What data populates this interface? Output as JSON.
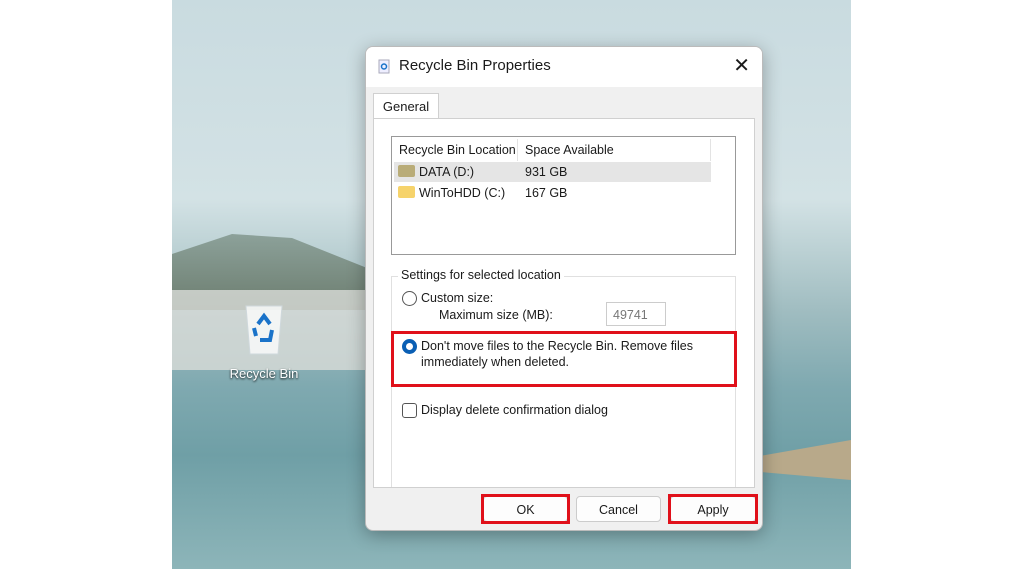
{
  "desktop": {
    "icon_label": "Recycle Bin"
  },
  "dialog": {
    "title": "Recycle Bin Properties",
    "close_icon": "close-icon",
    "tabs": [
      {
        "label": "General",
        "active": true
      }
    ],
    "list": {
      "headers": [
        "Recycle Bin Location",
        "Space Available"
      ],
      "rows": [
        {
          "location": "DATA (D:)",
          "space": "931 GB",
          "selected": true
        },
        {
          "location": "WinToHDD (C:)",
          "space": "167 GB",
          "selected": false
        }
      ]
    },
    "settings": {
      "group_label": "Settings for selected location",
      "custom_size_label": "Custom size:",
      "max_size_label": "Maximum size (MB):",
      "max_size_value": "49741",
      "dont_move_label_line1": "Don't move files to the Recycle Bin. Remove files",
      "dont_move_label_line2": "immediately when deleted.",
      "selected_option": "dont_move",
      "confirm_label": "Display delete confirmation dialog",
      "confirm_checked": false
    },
    "buttons": {
      "ok": "OK",
      "cancel": "Cancel",
      "apply": "Apply"
    },
    "highlight_color": "#e0101a"
  }
}
